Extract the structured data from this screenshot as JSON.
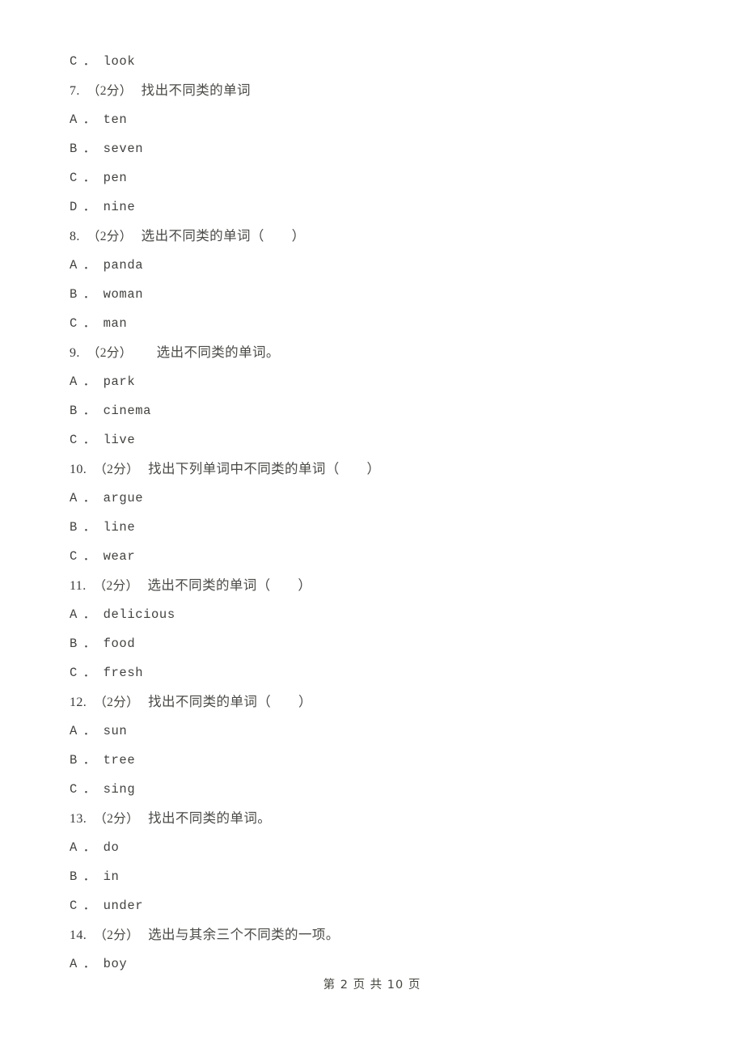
{
  "page": {
    "footer": "第 2 页 共 10 页",
    "page_number": "2",
    "total_pages": "10",
    "background_color": "#ffffff",
    "text_color": "#42423f"
  },
  "lines": [
    {
      "kind": "option",
      "letter": "C",
      "sep": "．",
      "word": "look"
    },
    {
      "kind": "question",
      "num": "7.",
      "score": "（2分）",
      "text": "找出不同类的单词",
      "paren": "",
      "extra_indent": false
    },
    {
      "kind": "option",
      "letter": "A",
      "sep": "．",
      "word": "ten"
    },
    {
      "kind": "option",
      "letter": "B",
      "sep": "．",
      "word": "seven"
    },
    {
      "kind": "option",
      "letter": "C",
      "sep": "．",
      "word": "pen"
    },
    {
      "kind": "option",
      "letter": "D",
      "sep": "．",
      "word": "nine"
    },
    {
      "kind": "question",
      "num": "8.",
      "score": "（2分）",
      "text": "选出不同类的单词",
      "paren": "（　　）",
      "extra_indent": false
    },
    {
      "kind": "option",
      "letter": "A",
      "sep": "．",
      "word": "panda"
    },
    {
      "kind": "option",
      "letter": "B",
      "sep": "．",
      "word": "woman"
    },
    {
      "kind": "option",
      "letter": "C",
      "sep": "．",
      "word": "man"
    },
    {
      "kind": "question",
      "num": "9.",
      "score": "（2分）",
      "text": "选出不同类的单词。",
      "paren": "",
      "extra_indent": true
    },
    {
      "kind": "option",
      "letter": "A",
      "sep": "．",
      "word": "park"
    },
    {
      "kind": "option",
      "letter": "B",
      "sep": "．",
      "word": "cinema"
    },
    {
      "kind": "option",
      "letter": "C",
      "sep": "．",
      "word": "live"
    },
    {
      "kind": "question",
      "num": "10.",
      "score": "（2分）",
      "text": "找出下列单词中不同类的单词",
      "paren": "（　　）",
      "extra_indent": false
    },
    {
      "kind": "option",
      "letter": "A",
      "sep": "．",
      "word": "argue"
    },
    {
      "kind": "option",
      "letter": "B",
      "sep": "．",
      "word": "line"
    },
    {
      "kind": "option",
      "letter": "C",
      "sep": "．",
      "word": "wear"
    },
    {
      "kind": "question",
      "num": "11.",
      "score": "（2分）",
      "text": "选出不同类的单词",
      "paren": "（　　）",
      "extra_indent": false
    },
    {
      "kind": "option",
      "letter": "A",
      "sep": "．",
      "word": "delicious"
    },
    {
      "kind": "option",
      "letter": "B",
      "sep": "．",
      "word": "food"
    },
    {
      "kind": "option",
      "letter": "C",
      "sep": "．",
      "word": "fresh"
    },
    {
      "kind": "question",
      "num": "12.",
      "score": "（2分）",
      "text": "找出不同类的单词",
      "paren": "（　　）",
      "extra_indent": false
    },
    {
      "kind": "option",
      "letter": "A",
      "sep": "．",
      "word": "sun"
    },
    {
      "kind": "option",
      "letter": "B",
      "sep": "．",
      "word": "tree"
    },
    {
      "kind": "option",
      "letter": "C",
      "sep": "．",
      "word": "sing"
    },
    {
      "kind": "question",
      "num": "13.",
      "score": "（2分）",
      "text": "找出不同类的单词。",
      "paren": "",
      "extra_indent": false
    },
    {
      "kind": "option",
      "letter": "A",
      "sep": "．",
      "word": "do"
    },
    {
      "kind": "option",
      "letter": "B",
      "sep": "．",
      "word": "in"
    },
    {
      "kind": "option",
      "letter": "C",
      "sep": "．",
      "word": "under"
    },
    {
      "kind": "question",
      "num": "14.",
      "score": "（2分）",
      "text": "选出与其余三个不同类的一项。",
      "paren": "",
      "extra_indent": false
    },
    {
      "kind": "option",
      "letter": "A",
      "sep": "．",
      "word": "boy"
    }
  ]
}
